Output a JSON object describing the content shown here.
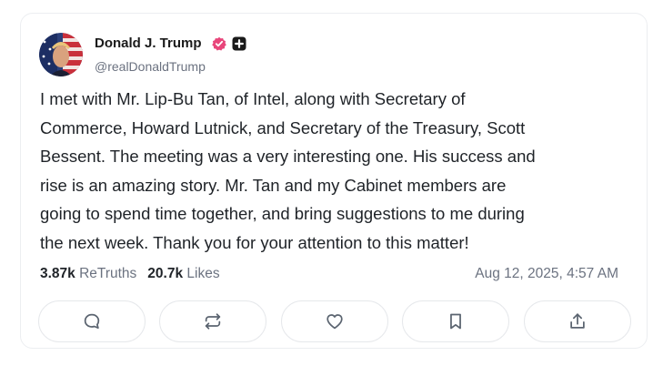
{
  "post": {
    "author": {
      "display_name": "Donald J. Trump",
      "handle": "@realDonaldTrump",
      "avatar_icon": "avatar-flag-portrait",
      "verified_icon": "verified-check-icon",
      "verified_color": "#e8457a",
      "extra_badge_icon": "plus-badge-icon"
    },
    "text_lines": [
      "I met with Mr. Lip-Bu Tan, of Intel, along with Secretary of",
      "Commerce, Howard Lutnick, and Secretary of the Treasury, Scott",
      "Bessent. The meeting was a very interesting one. His success and",
      "rise is an amazing story. Mr. Tan and my Cabinet members are",
      "going to spend time together, and bring suggestions to me during",
      "the next week. Thank you for your attention to this matter!"
    ],
    "stats": {
      "retruths_count": "3.87k",
      "retruths_label": "ReTruths",
      "likes_count": "20.7k",
      "likes_label": "Likes"
    },
    "timestamp": "Aug 12, 2025, 4:57 AM"
  },
  "actions": [
    {
      "name": "reply",
      "icon": "comment-icon"
    },
    {
      "name": "retruth",
      "icon": "repost-icon"
    },
    {
      "name": "like",
      "icon": "heart-icon"
    },
    {
      "name": "bookmark",
      "icon": "bookmark-icon"
    },
    {
      "name": "share",
      "icon": "share-icon"
    }
  ],
  "colors": {
    "text": "#1f2328",
    "muted": "#6b7280",
    "border": "#e6e8eb",
    "icon": "#5b6470"
  }
}
